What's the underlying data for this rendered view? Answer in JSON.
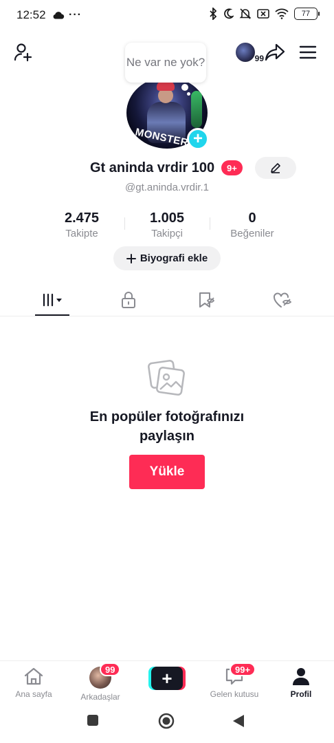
{
  "status_bar": {
    "time": "12:52",
    "more": "···",
    "battery": "77"
  },
  "top_bar": {
    "story_badge": "99"
  },
  "bubble": {
    "text": "Ne var ne yok?"
  },
  "profile": {
    "avatar_text": "MONSTER A",
    "display_name": "Gt aninda vrdir 100",
    "notification_badge": "9+",
    "username": "@gt.aninda.vrdir.1"
  },
  "stats": [
    {
      "value": "2.475",
      "label": "Takipte"
    },
    {
      "value": "1.005",
      "label": "Takipçi"
    },
    {
      "value": "0",
      "label": "Beğeniler"
    }
  ],
  "bio_button": "Biyografi ekle",
  "tabs": [
    {
      "icon": "grid-icon",
      "active": true
    },
    {
      "icon": "lock-icon",
      "active": false
    },
    {
      "icon": "bookmark-icon",
      "active": false
    },
    {
      "icon": "liked-icon",
      "active": false
    }
  ],
  "empty_state": {
    "title": "En popüler fotoğrafınızı paylaşın",
    "button": "Yükle"
  },
  "bottom_nav": {
    "home": "Ana sayfa",
    "friends": "Arkadaşlar",
    "friends_badge": "99",
    "inbox": "Gelen kutusu",
    "inbox_badge": "99+",
    "profile": "Profil",
    "create_symbol": "+"
  },
  "colors": {
    "accent": "#fe2c55",
    "cyan": "#25f4ee",
    "text": "#161823",
    "muted": "#8a8b91"
  }
}
